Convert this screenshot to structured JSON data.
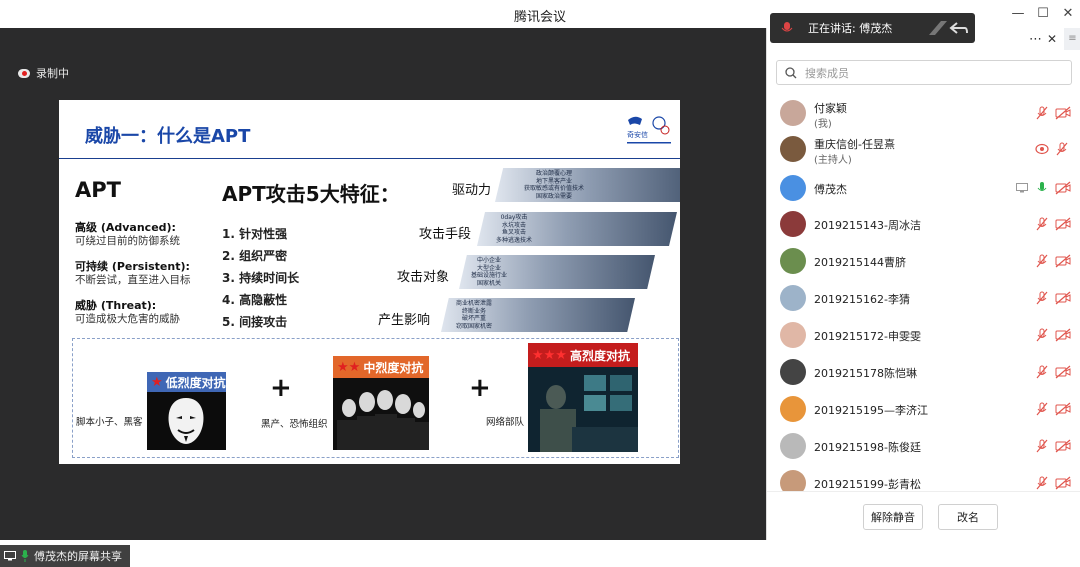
{
  "window": {
    "title": "腾讯会议",
    "controls": {
      "minimize": "—",
      "maximize": "☐",
      "close": "✕"
    }
  },
  "stage": {
    "recording_label": "录制中",
    "presenter_label": "傅茂杰的屏幕共享"
  },
  "slide": {
    "title": "威胁一：什么是APT",
    "logo_text": "奇安信",
    "apt_heading": "APT",
    "left_items": [
      {
        "heading": "高级 (Advanced):",
        "text": "可绕过目前的防御系统"
      },
      {
        "heading": "可持续 (Persistent):",
        "text": "不断尝试，直至进入目标"
      },
      {
        "heading": "威胁 (Threat):",
        "text": "可造成极大危害的威胁"
      }
    ],
    "features_title": "APT攻击5大特征：",
    "features": [
      "1.  针对性强",
      "2.  组织严密",
      "3.  持续时间长",
      "4.  高隐蔽性",
      "5.  间接攻击"
    ],
    "bands": [
      {
        "label": "驱动力",
        "details": [
          "政治颠覆心理",
          "地下黑客产业",
          "获取敏感或有价值技术",
          "国家政治需要"
        ]
      },
      {
        "label": "攻击手段",
        "details": [
          "0day攻击",
          "水坑攻击",
          "鱼叉攻击",
          "多种逃逸技术"
        ]
      },
      {
        "label": "攻击对象",
        "details": [
          "中小企业",
          "大型企业",
          "基础设施行业",
          "国家机关"
        ]
      },
      {
        "label": "产生影响",
        "details": [
          "商业机密泄露",
          "终断业务",
          "破坏严重",
          "窃取国家机密"
        ]
      }
    ],
    "tiers": [
      {
        "stars": "★",
        "label": "低烈度对抗",
        "caption": "脚本小子、黑客",
        "color": "#3f67b5"
      },
      {
        "stars": "★★",
        "label": "中烈度对抗",
        "caption": "黑产、恐怖组织",
        "color": "#e2672a"
      },
      {
        "stars": "★★★",
        "label": "高烈度对抗",
        "caption": "网络部队",
        "color": "#c41d1d"
      }
    ],
    "plus": "+"
  },
  "panel": {
    "speaking_label": "正在讲话: 傅茂杰",
    "more": "⋯",
    "close": "✕",
    "search_placeholder": "搜索成员",
    "members": [
      {
        "name": "付家颖",
        "role": "(我)",
        "avatar": "#c8a79a",
        "mic": "muted",
        "cam": "off"
      },
      {
        "name": "重庆信创-任昱熹",
        "role": "(主持人)",
        "avatar": "#7a5a3e",
        "mic": "recording",
        "cam": "off"
      },
      {
        "name": "傅茂杰",
        "role": "",
        "avatar": "#4a90e2",
        "mic": "active",
        "cam": "off",
        "sharing": true
      },
      {
        "name": "2019215143-周冰洁",
        "role": "",
        "avatar": "#8b3a3a",
        "mic": "muted",
        "cam": "off"
      },
      {
        "name": "2019215144曹脐",
        "role": "",
        "avatar": "#6b8e4e",
        "mic": "muted",
        "cam": "off"
      },
      {
        "name": "2019215162-李猜",
        "role": "",
        "avatar": "#9db3c9",
        "mic": "muted",
        "cam": "off"
      },
      {
        "name": "2019215172-申雯雯",
        "role": "",
        "avatar": "#e0b7a6",
        "mic": "muted",
        "cam": "off"
      },
      {
        "name": "2019215178陈恺琳",
        "role": "",
        "avatar": "#444444",
        "mic": "muted",
        "cam": "off"
      },
      {
        "name": "2019215195—李济江",
        "role": "",
        "avatar": "#e8953a",
        "mic": "muted",
        "cam": "off"
      },
      {
        "name": "2019215198-陈俊廷",
        "role": "",
        "avatar": "#b9b9b9",
        "mic": "muted",
        "cam": "off"
      },
      {
        "name": "2019215199-彭青松",
        "role": "",
        "avatar": "#c79a7a",
        "mic": "muted",
        "cam": "off"
      }
    ],
    "unmute_all": "解除静音",
    "rename": "改名"
  },
  "colors": {
    "title_blue": "#1a47a8",
    "muted_red": "#e0554d",
    "active_green": "#2bb24c",
    "stage_bg": "#2b2b2c"
  }
}
